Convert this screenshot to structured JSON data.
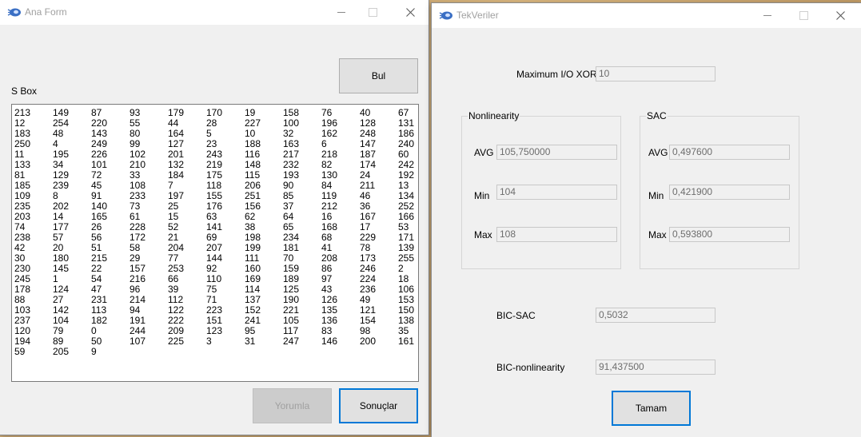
{
  "colors": {
    "accent": "#0078d7",
    "window_bg": "#f0f0f0"
  },
  "ana_form": {
    "title": "Ana Form",
    "bul_label": "Bul",
    "sbox_label": "S Box",
    "sbox_values": [
      "213",
      "149",
      "87",
      "93",
      "179",
      "170",
      "19",
      "158",
      "76",
      "40",
      "67",
      "12",
      "254",
      "220",
      "55",
      "44",
      "28",
      "227",
      "100",
      "196",
      "128",
      "131",
      "183",
      "48",
      "143",
      "80",
      "164",
      "5",
      "10",
      "32",
      "162",
      "248",
      "186",
      "250",
      "4",
      "249",
      "99",
      "127",
      "23",
      "188",
      "163",
      "6",
      "147",
      "240",
      "11",
      "195",
      "226",
      "102",
      "201",
      "243",
      "116",
      "217",
      "218",
      "187",
      "60",
      "133",
      "34",
      "101",
      "210",
      "132",
      "219",
      "148",
      "232",
      "82",
      "174",
      "242",
      "81",
      "129",
      "72",
      "33",
      "184",
      "175",
      "115",
      "193",
      "130",
      "24",
      "192",
      "185",
      "239",
      "45",
      "108",
      "7",
      "118",
      "206",
      "90",
      "84",
      "211",
      "13",
      "109",
      "8",
      "91",
      "233",
      "197",
      "155",
      "251",
      "85",
      "119",
      "46",
      "134",
      "235",
      "202",
      "140",
      "73",
      "25",
      "176",
      "156",
      "37",
      "212",
      "36",
      "252",
      "203",
      "14",
      "165",
      "61",
      "15",
      "63",
      "62",
      "64",
      "16",
      "167",
      "166",
      "74",
      "177",
      "26",
      "228",
      "52",
      "141",
      "38",
      "65",
      "168",
      "17",
      "53",
      "238",
      "57",
      "56",
      "172",
      "21",
      "69",
      "198",
      "234",
      "68",
      "229",
      "171",
      "42",
      "20",
      "51",
      "58",
      "204",
      "207",
      "199",
      "181",
      "41",
      "78",
      "139",
      "30",
      "180",
      "215",
      "29",
      "77",
      "144",
      "111",
      "70",
      "208",
      "173",
      "255",
      "230",
      "145",
      "22",
      "157",
      "253",
      "92",
      "160",
      "159",
      "86",
      "246",
      "2",
      "245",
      "1",
      "54",
      "216",
      "66",
      "110",
      "169",
      "189",
      "97",
      "224",
      "18",
      "178",
      "124",
      "47",
      "96",
      "39",
      "75",
      "114",
      "125",
      "43",
      "236",
      "106",
      "88",
      "27",
      "231",
      "214",
      "112",
      "71",
      "137",
      "190",
      "126",
      "49",
      "153",
      "103",
      "142",
      "113",
      "94",
      "122",
      "223",
      "152",
      "221",
      "135",
      "121",
      "150",
      "237",
      "104",
      "182",
      "191",
      "222",
      "151",
      "241",
      "105",
      "136",
      "154",
      "138",
      "120",
      "79",
      "0",
      "244",
      "209",
      "123",
      "95",
      "117",
      "83",
      "98",
      "35",
      "194",
      "89",
      "50",
      "107",
      "225",
      "3",
      "31",
      "247",
      "146",
      "200",
      "161",
      "59",
      "205",
      "9"
    ],
    "yorumla_label": "Yorumla",
    "sonuclar_label": "Sonuçlar"
  },
  "tek_veriler": {
    "title": "TekVeriler",
    "max_io_xor_label": "Maximum I/O XOR",
    "max_io_xor_value": "10",
    "nonlinearity": {
      "title": "Nonlinearity",
      "avg_label": "AVG",
      "avg_value": "105,750000",
      "min_label": "Min",
      "min_value": "104",
      "max_label": "Max",
      "max_value": "108"
    },
    "sac": {
      "title": "SAC",
      "avg_label": "AVG",
      "avg_value": "0,497600",
      "min_label": "Min",
      "min_value": "0,421900",
      "max_label": "Max",
      "max_value": "0,593800"
    },
    "bic_sac_label": "BIC-SAC",
    "bic_sac_value": "0,5032",
    "bic_nonlinearity_label": "BIC-nonlinearity",
    "bic_nonlinearity_value": "91,437500",
    "tamam_label": "Tamam"
  }
}
